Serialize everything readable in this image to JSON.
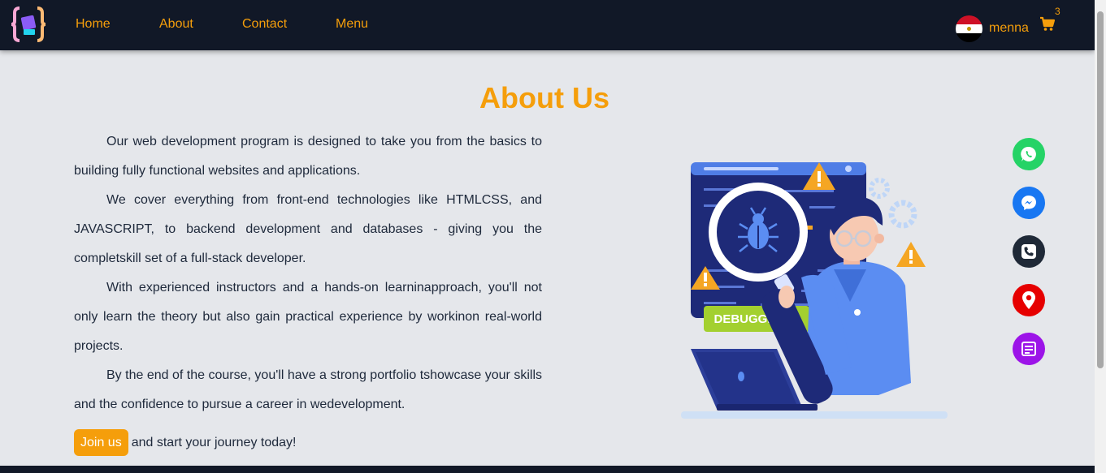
{
  "nav": {
    "links": [
      "Home",
      "About",
      "Contact",
      "Menu"
    ],
    "username": "menna",
    "cart_count": "3"
  },
  "about": {
    "title": "About Us",
    "paragraphs": [
      "Our web development program is designed to take you from the basics to building fully functional websites and applications.",
      "We cover everything from front-end technologies like HTMLCSS, and JAVASCRIPT, to backend development and databases - giving you the completskill set of a full-stack developer.",
      "With experienced instructors and a hands-on learninapproach, you'll not only learn the theory but also gain practical experience by workinon real-world projects.",
      "By the end of the course, you'll have a strong portfolio tshowcase your skills and the confidence to pursue a career in wedevelopment."
    ],
    "join_button": "Join us",
    "join_rest": "and start your journey today!"
  },
  "illustration": {
    "badge": "DEBUGGING..."
  },
  "icons": {
    "logo": "code-braces-logo",
    "flag": "egypt-flag",
    "cart": "shopping-cart-icon",
    "social": [
      "whatsapp-icon",
      "messenger-icon",
      "phone-icon",
      "location-icon",
      "menu-card-icon"
    ]
  },
  "colors": {
    "nav_bg": "#111827",
    "accent": "#f59e0b",
    "page_bg": "#e5e7eb",
    "whatsapp": "#25d366",
    "messenger": "#1877f2",
    "phone": "#1f2937",
    "location": "#e60000",
    "menu": "#9c14e8"
  }
}
